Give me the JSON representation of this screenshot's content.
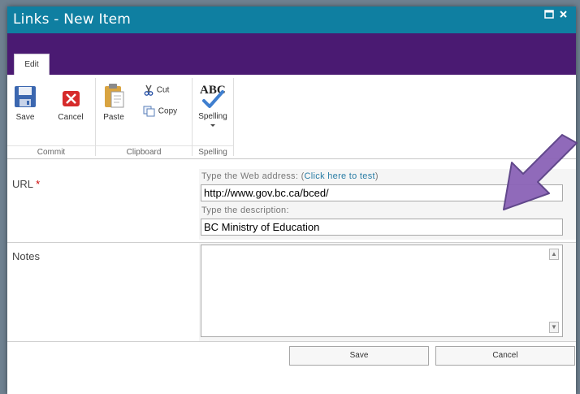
{
  "window": {
    "title": "Links - New Item"
  },
  "ribbon": {
    "tabs": [
      {
        "label": "Edit",
        "selected": true
      }
    ],
    "groups": {
      "commit": {
        "label": "Commit",
        "save": "Save",
        "cancel": "Cancel"
      },
      "clipboard": {
        "label": "Clipboard",
        "paste": "Paste",
        "cut": "Cut",
        "copy": "Copy"
      },
      "spelling": {
        "label": "Spelling",
        "spelling_button": "Spelling",
        "abc_glyph": "ABC"
      }
    }
  },
  "form": {
    "url": {
      "label": "URL",
      "required_marker": "*",
      "address_hint": "Type the Web address: (",
      "test_link": "Click here to test",
      "address_hint_close": ")",
      "address_value": "http://www.gov.bc.ca/bced/",
      "description_hint": "Type the description:",
      "description_value": "BC Ministry of Education"
    },
    "notes": {
      "label": "Notes",
      "value": ""
    }
  },
  "buttons": {
    "save": "Save",
    "cancel": "Cancel"
  },
  "colors": {
    "title_bar": "#0f7fa1",
    "ribbon_band": "#4a1a72",
    "link": "#2a7da5",
    "required": "#cc0000",
    "annotation_arrow": "#8b63b7"
  },
  "icons": [
    "maximize-icon",
    "close-icon",
    "save-disk-icon",
    "cancel-x-icon",
    "paste-clipboard-icon",
    "cut-scissors-icon",
    "copy-icon",
    "spelling-check-icon",
    "dropdown-arrow-icon",
    "annotation-arrow"
  ]
}
